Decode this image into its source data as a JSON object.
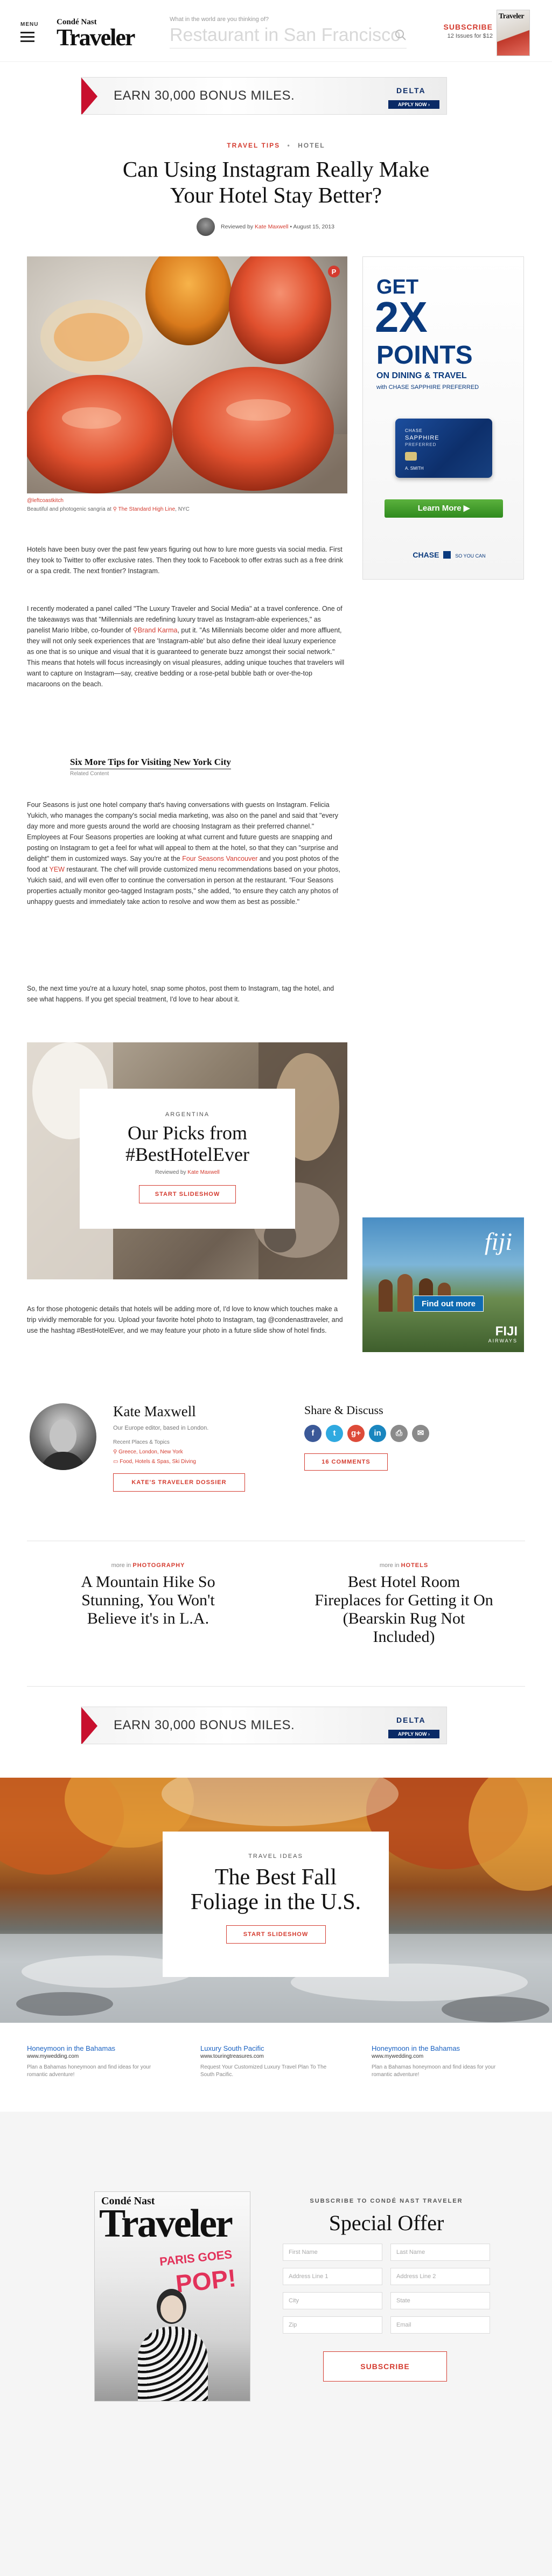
{
  "header": {
    "menu_label": "MENU",
    "logo_top": "Condé Nast",
    "logo_main": "Traveler",
    "search_prompt": "What in the world are you thinking of?",
    "search_placeholder": "Restaurant in San Francisco",
    "subscribe_label": "SUBSCRIBE",
    "subscribe_offer": "12 Issues for $12",
    "cover_title": "Traveler"
  },
  "ad_top": {
    "text": "EARN 30,000 BONUS MILES.",
    "brand": "DELTA",
    "cta": "APPLY NOW ›"
  },
  "article": {
    "section": "TRAVEL TIPS",
    "section_sep": "•",
    "subsection": "HOTEL",
    "title_line1": "Can Using Instagram Really Make",
    "title_line2": "Your Hotel Stay Better?",
    "byline_prefix": "Reviewed by",
    "byline_author": "Kate Maxwell",
    "byline_date": "• August 15, 2013",
    "photo_credit": "@leftcoastkitch",
    "caption_pre": "Beautiful and photogenic sangria at",
    "caption_link": "The Standard High Line",
    "caption_post": ", NYC",
    "p1": "Hotels have been busy over the past few years figuring out how to lure more guests via social media. First they took to Twitter to offer exclusive rates. Then they took to Facebook to offer extras such as a free drink or a spa credit. The next frontier? Instagram.",
    "p2_a": "I recently moderated a panel called \"The Luxury Traveler and Social Media\" at a travel conference. One of the takeaways was that \"Millennials are redefining luxury travel as Instagram-able experiences,\" as panelist Mario Iribbe, co-founder of ",
    "p2_link": "Brand Karma",
    "p2_b": ", put it. \"As Millennials become older and more affluent, they will not only seek experiences that are 'Instagram-able' but also define their ideal luxury experience as one that is so unique and visual that it is guaranteed to generate buzz amongst their social network.\" This means that hotels will focus increasingly on visual pleasures, adding unique touches that travelers will want to capture on Instagram—say, creative bedding or a rose-petal bubble bath or over-the-top macaroons on the beach.",
    "related_title": "Six More Tips for Visiting New York City",
    "related_label": "Related Content",
    "p3_a": "Four Seasons is just one hotel company that's having conversations with guests on Instagram. Felicia Yukich, who manages the company's social media marketing, was also on the panel and said that \"every day more and more guests around the world are choosing Instagram as their preferred channel.\" Employees at Four Seasons properties are looking at what current and future guests are snapping and posting on Instagram to get a feel for what will appeal to them at the hotel, so that they can \"surprise and delight\" them in customized ways. Say you're at the ",
    "p3_link": "Four Seasons Vancouver",
    "p3_b": " and you post photos of the food at ",
    "p3_link2": "YEW",
    "p3_c": " restaurant. The chef will provide customized menu recommendations based on your photos, Yukich said, and will even offer to continue the conversation in person at the restaurant. \"Four Seasons properties actually monitor geo-tagged Instagram posts,\" she added, \"to ensure they catch any photos of unhappy guests and immediately take action to resolve and wow them as best as possible.\"",
    "p4": "So, the next time you're at a luxury hotel, snap some photos, post them to Instagram, tag the hotel, and see what happens. If you get special treatment, I'd love to hear about it.",
    "p5": "As for those photogenic details that hotels will be adding more of, I'd love to know which touches make a trip vividly memorable for you. Upload your favorite hotel photo to Instagram, tag @condenasttraveler, and use the hashtag #BestHotelEver, and we may feature your photo in a future slide show of hotel finds."
  },
  "slideshow_card": {
    "kicker": "ARGENTINA",
    "title_line1": "Our Picks from",
    "title_line2": "#BestHotelEver",
    "byline_prefix": "Reviewed by",
    "byline_author": "Kate Maxwell",
    "cta": "START SLIDESHOW"
  },
  "ad_chase": {
    "get": "GET",
    "big": "2X",
    "points": "POINTS",
    "on": "ON DINING & TRAVEL",
    "with": "with CHASE SAPPHIRE PREFERRED",
    "card_line1": "CHASE",
    "card_line2": "SAPPHIRE",
    "card_line3": "PREFERRED",
    "card_name": "A. SMITH",
    "learn_more": "Learn More ▶",
    "brand": "CHASE",
    "tagline": "SO YOU CAN"
  },
  "ad_fiji": {
    "brand": "fiji",
    "cta": "Find out more",
    "footer_brand": "FIJI",
    "footer_sub": "AIRWAYS"
  },
  "author": {
    "name": "Kate Maxwell",
    "bio": "Our Europe editor, based in London.",
    "recent_label": "Recent Places & Topics",
    "places": "Greece, London, New York",
    "topics": "Food, Hotels & Spas, Ski Diving",
    "dossier_btn": "KATE'S TRAVELER DOSSIER"
  },
  "share": {
    "title": "Share & Discuss",
    "comments_btn": "16 COMMENTS",
    "icons": [
      {
        "name": "facebook-icon",
        "glyph": "f",
        "color": "#3b5998"
      },
      {
        "name": "twitter-icon",
        "glyph": "t",
        "color": "#2fa9e0"
      },
      {
        "name": "google-plus-icon",
        "glyph": "g+",
        "color": "#dd4b39"
      },
      {
        "name": "linkedin-icon",
        "glyph": "in",
        "color": "#1a86bf"
      },
      {
        "name": "print-icon",
        "glyph": "⎙",
        "color": "#8a8a8a"
      },
      {
        "name": "email-icon",
        "glyph": "✉",
        "color": "#8a8a8a"
      }
    ]
  },
  "more": [
    {
      "prefix": "more in",
      "category": "PHOTOGRAPHY",
      "title_lines": [
        "A Mountain Hike So",
        "Stunning, You Won't",
        "Believe it's in L.A."
      ]
    },
    {
      "prefix": "more in",
      "category": "HOTELS",
      "title_lines": [
        "Best Hotel Room",
        "Fireplaces for Getting it On",
        "(Bearskin Rug Not",
        "Included)"
      ]
    }
  ],
  "ad_mid": {
    "text": "EARN 30,000 BONUS MILES.",
    "brand": "DELTA",
    "cta": "APPLY NOW ›"
  },
  "foliage": {
    "kicker": "TRAVEL IDEAS",
    "title_line1": "The Best Fall",
    "title_line2": "Foliage in the U.S.",
    "cta": "START SLIDESHOW"
  },
  "sponsored": [
    {
      "title": "Honeymoon in the Bahamas",
      "url": "www.mywedding.com",
      "desc": "Plan a Bahamas honeymoon and find ideas for your romantic adventure!"
    },
    {
      "title": "Luxury South Pacific",
      "url": "www.touringtreasures.com",
      "desc": "Request Your Customized Luxury Travel Plan To The South Pacific."
    },
    {
      "title": "Honeymoon in the Bahamas",
      "url": "www.mywedding.com",
      "desc": "Plan a Bahamas honeymoon and find ideas for your romantic adventure!"
    }
  ],
  "subscribe": {
    "cover_top": "Condé Nast",
    "cover_title": "Traveler",
    "cover_headline_1": "PARIS GOES",
    "cover_headline_2": "POP!",
    "kicker": "SUBSCRIBE TO CONDÉ NAST TRAVELER",
    "title": "Special Offer",
    "fields": {
      "first_name": "First Name",
      "last_name": "Last Name",
      "address1": "Address Line 1",
      "address2": "Address Line 2",
      "city": "City",
      "state": "State",
      "zip": "Zip",
      "email": "Email"
    },
    "button": "SUBSCRIBE"
  }
}
